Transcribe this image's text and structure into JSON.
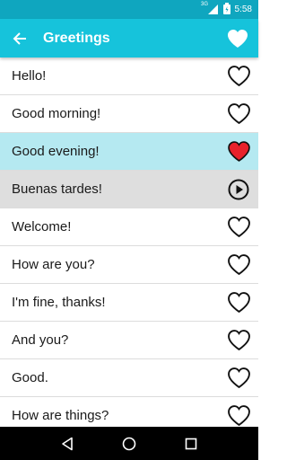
{
  "status_bar": {
    "network_label": "3G",
    "time": "5:58"
  },
  "app_bar": {
    "back_icon": "arrow-left-icon",
    "title": "Greetings",
    "favorites_icon": "heart-filled-icon"
  },
  "phrases": [
    {
      "text": "Hello!",
      "state": "normal",
      "icon": "heart-outline-icon"
    },
    {
      "text": "Good morning!",
      "state": "normal",
      "icon": "heart-outline-icon"
    },
    {
      "text": "Good evening!",
      "state": "favorited",
      "icon": "heart-filled-red-icon"
    },
    {
      "text": "Buenas tardes!",
      "state": "translation",
      "icon": "play-circle-icon"
    },
    {
      "text": "Welcome!",
      "state": "normal",
      "icon": "heart-outline-icon"
    },
    {
      "text": "How are you?",
      "state": "normal",
      "icon": "heart-outline-icon"
    },
    {
      "text": "I'm fine, thanks!",
      "state": "normal",
      "icon": "heart-outline-icon"
    },
    {
      "text": "And you?",
      "state": "normal",
      "icon": "heart-outline-icon"
    },
    {
      "text": "Good.",
      "state": "normal",
      "icon": "heart-outline-icon"
    },
    {
      "text": "How are things?",
      "state": "normal",
      "icon": "heart-outline-icon"
    }
  ],
  "colors": {
    "status_bar": "#0fa6bf",
    "app_bar": "#16c3db",
    "selected_row": "#b5e9f1",
    "translation_row": "#dedede",
    "favorite_heart": "#e8222b"
  },
  "nav_bar": [
    "back-triangle-icon",
    "home-circle-icon",
    "recents-square-icon"
  ]
}
